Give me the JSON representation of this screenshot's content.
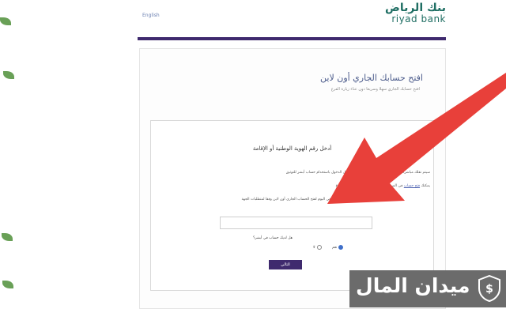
{
  "header": {
    "lang_link": "English",
    "logo_arabic": "بنك الرياض",
    "logo_english": "riyad bank"
  },
  "page": {
    "title": "افتح حسابك الجاري أون لاين",
    "subtitle": "افتح حسابك الجاري سهلا وسريعا دون عناء زيارة الفرع"
  },
  "form": {
    "heading": "أدخل رقم الهوية الوطنية أو الإقامة",
    "info_line_1": "سيتم نقلك مباشرة إلى منصة النفاذ الوطني الموحد لتسجيل الدخول باستخدام حساب أبشر للتوثيق",
    "info_line_2_pre": "يمكنك",
    "info_line_2_link_a": "فتح حساب",
    "info_line_2_mid": "في المرة الأولى، أو",
    "info_line_2_link_b": "المتابعة",
    "info_line_2_post": "وزيارة أقرب فرع",
    "info_line_3": "احصل على خدماتك في اليوم لفتح الحساب الجاري أون لاين وفقا لمتطلبات الجهة",
    "id_placeholder": "",
    "question": "هل لديك حساب في أبشر؟",
    "radio_yes": "نعم",
    "radio_no": "لا",
    "next_button": "التالي"
  },
  "watermark": {
    "text": "ميدان المال"
  },
  "colors": {
    "brand_purple": "#3f2a6e",
    "brand_green": "#1f6e63",
    "arrow_red": "#e8403a"
  }
}
